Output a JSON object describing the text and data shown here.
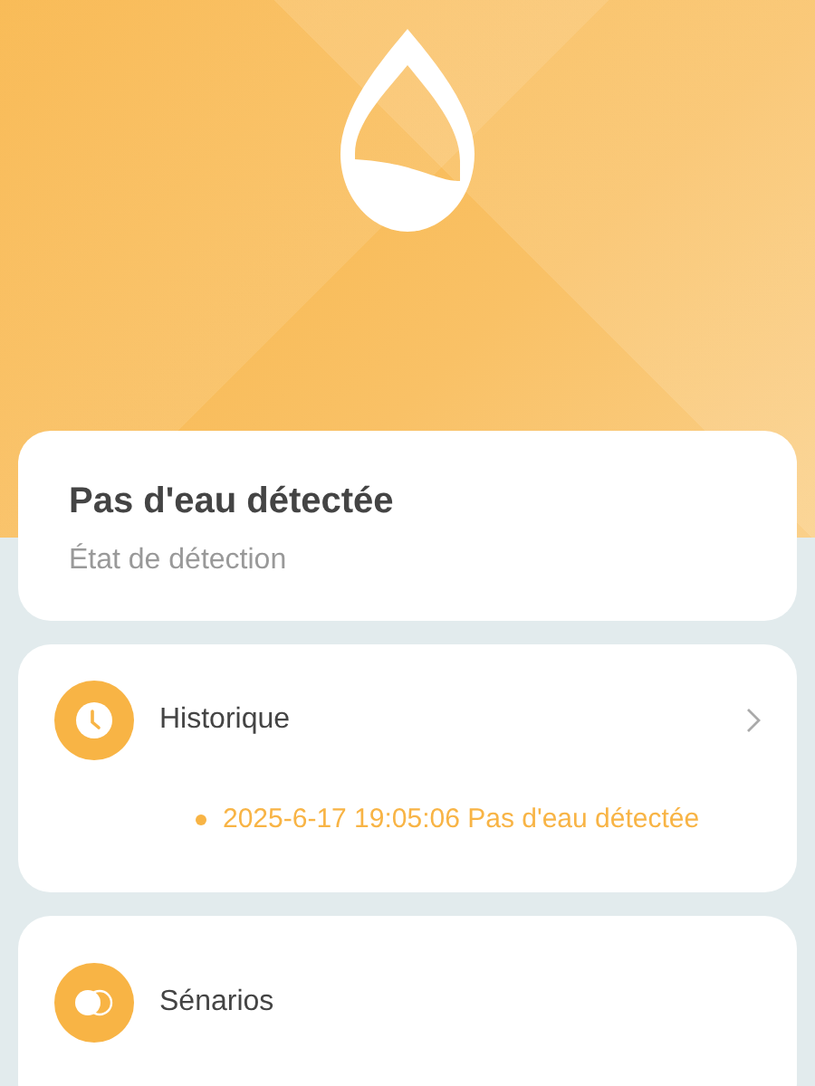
{
  "status": {
    "title": "Pas d'eau détectée",
    "subtitle": "État de détection"
  },
  "history": {
    "title": "Historique",
    "entries": [
      {
        "text": "2025-6-17 19:05:06 Pas d'eau détectée"
      }
    ]
  },
  "scenarios": {
    "title": "Sénarios"
  }
}
